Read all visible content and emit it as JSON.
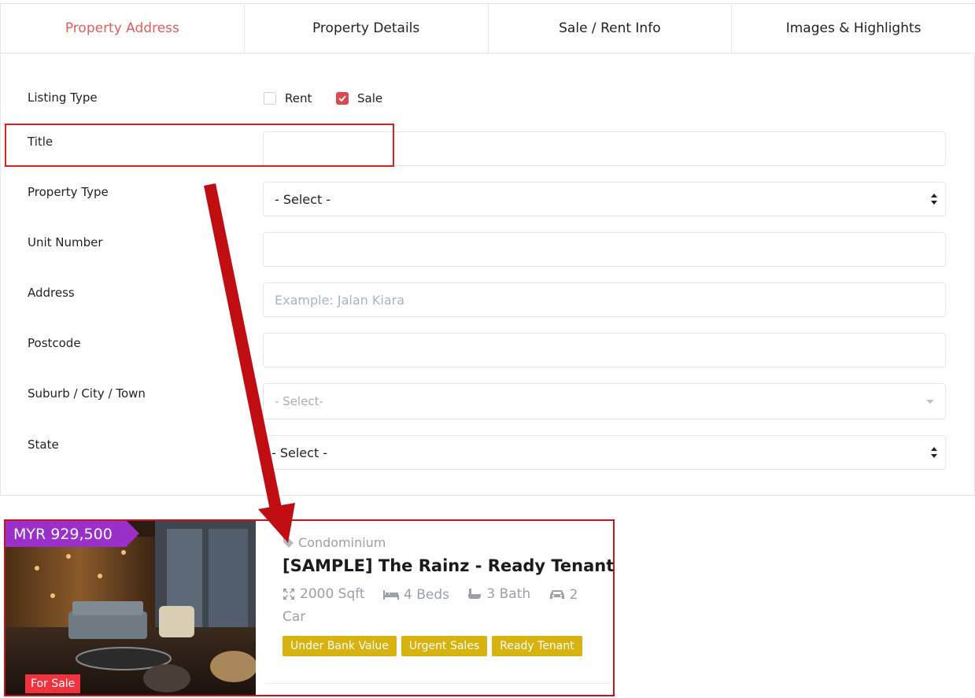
{
  "tabs": [
    {
      "label": "Property Address",
      "active": true
    },
    {
      "label": "Property Details"
    },
    {
      "label": "Sale / Rent Info"
    },
    {
      "label": "Images & Highlights"
    }
  ],
  "form": {
    "listing_type": {
      "label": "Listing Type",
      "rent_label": "Rent",
      "rent_checked": false,
      "sale_label": "Sale",
      "sale_checked": true
    },
    "title": {
      "label": "Title",
      "value": ""
    },
    "property_type": {
      "label": "Property Type",
      "value": "- Select -"
    },
    "unit_number": {
      "label": "Unit Number",
      "value": ""
    },
    "address": {
      "label": "Address",
      "placeholder": "Example: Jalan Kiara"
    },
    "postcode": {
      "label": "Postcode",
      "value": ""
    },
    "suburb": {
      "label": "Suburb / City / Town",
      "value": "- Select-"
    },
    "state": {
      "label": "State",
      "value": "- Select -"
    }
  },
  "listing_card": {
    "price": "MYR 929,500",
    "status_badge": "For Sale",
    "property_type": "Condominium",
    "title": "[SAMPLE] The Rainz - Ready Tenant",
    "size": "2000 Sqft",
    "beds": "4 Beds",
    "baths": "3 Bath",
    "car_line1": "2",
    "car_line2": "Car",
    "tags": [
      "Under Bank Value",
      "Urgent Sales",
      "Ready Tenant"
    ]
  },
  "colors": {
    "accent": "#e35d5b",
    "checkbox": "#e0474c",
    "price_tag": "#9b2fc9",
    "tag": "#d8b20e",
    "annotation": "#c7141a"
  },
  "icons": [
    "checkmark-icon",
    "select-arrows-icon",
    "chevron-down-icon",
    "tag-icon",
    "area-icon",
    "bed-icon",
    "bath-icon",
    "car-icon",
    "annotation-arrow-icon"
  ]
}
